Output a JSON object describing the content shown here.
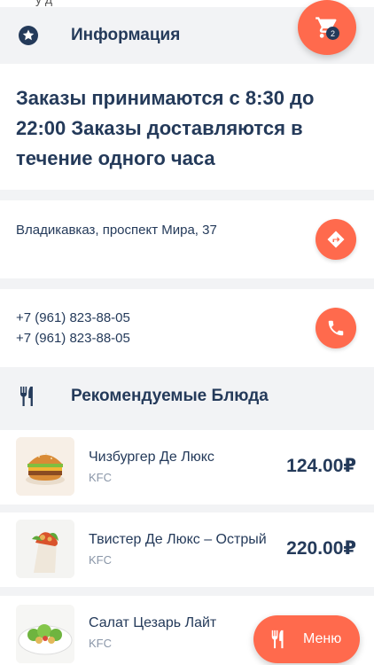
{
  "header": {
    "partial_text": "у д "
  },
  "info_section": {
    "title": "Информация",
    "icon": "star-icon"
  },
  "hours": {
    "text": "Заказы принимаются с 8:30 до 22:00 Заказы доставляются в течение одного часа"
  },
  "address": {
    "text": "Владикавказ, проспект Мира, 37",
    "icon": "directions-icon"
  },
  "phones": {
    "line1": "+7 (961) 823-88-05",
    "line2": "+7 (961) 823-88-05",
    "icon": "phone-icon"
  },
  "recommended": {
    "title": "Рекомендуемые Блюда",
    "icon": "cutlery-icon"
  },
  "dishes": [
    {
      "name": "Чизбургер Де Люкс",
      "brand": "KFC",
      "price": "124.00₽"
    },
    {
      "name": "Твистер Де Люкс – Острый",
      "brand": "KFC",
      "price": "220.00₽"
    },
    {
      "name": "Салат Цезарь Лайт",
      "brand": "KFC",
      "price": ""
    }
  ],
  "cart": {
    "count": "2",
    "icon": "cart-icon"
  },
  "menu_button": {
    "label": "Меню",
    "icon": "cutlery-icon"
  },
  "colors": {
    "accent": "#ff6a4d",
    "text": "#243a5a",
    "muted": "#8a96a8",
    "background": "#f2f3f5"
  }
}
